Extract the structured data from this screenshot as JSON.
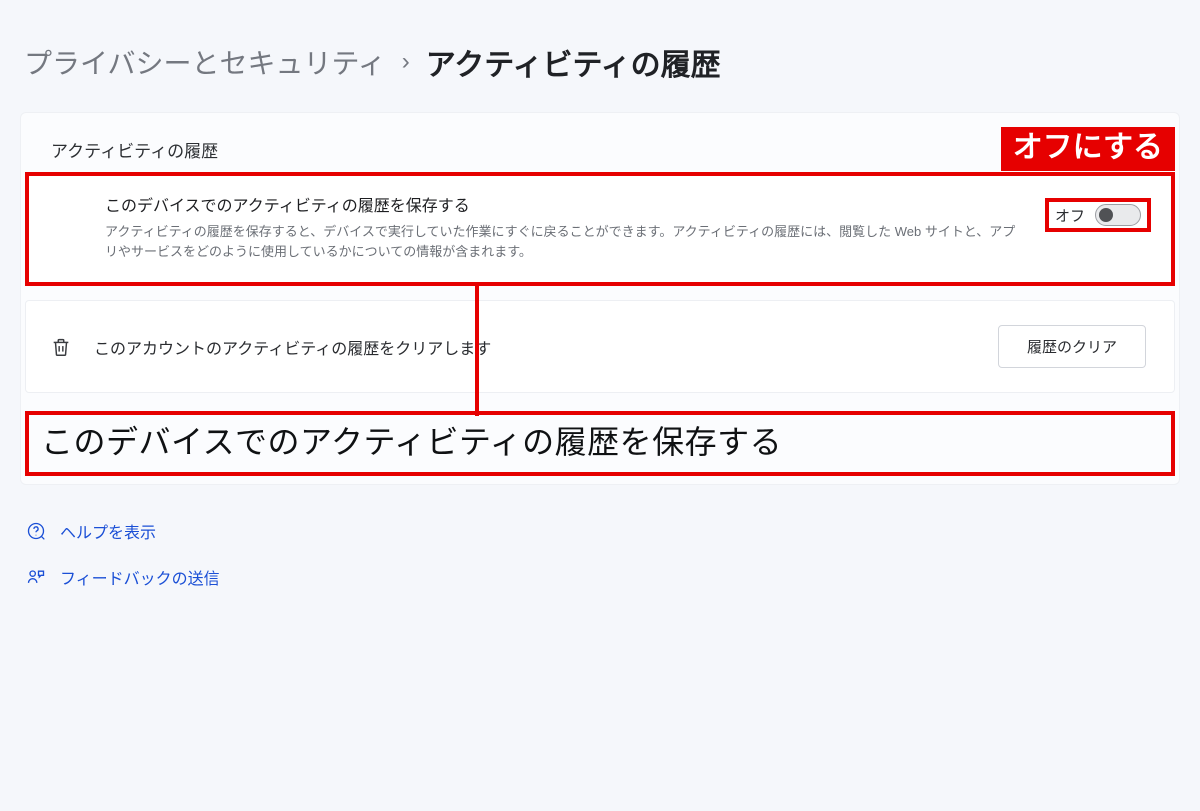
{
  "breadcrumb": {
    "parent": "プライバシーとセキュリティ",
    "current": "アクティビティの履歴"
  },
  "section": {
    "title": "アクティビティの履歴"
  },
  "callout": {
    "label": "オフにする"
  },
  "setting": {
    "title": "このデバイスでのアクティビティの履歴を保存する",
    "desc": "アクティビティの履歴を保存すると、デバイスで実行していた作業にすぐに戻ることができます。アクティビティの履歴には、閲覧した Web サイトと、アプリやサービスをどのように使用しているかについての情報が含まれます。",
    "toggle_label": "オフ",
    "toggle_state": "off"
  },
  "clear": {
    "text": "このアカウントのアクティビティの履歴をクリアします",
    "button": "履歴のクリア"
  },
  "enlarge": {
    "text": "このデバイスでのアクティビティの履歴を保存する"
  },
  "links": {
    "help": "ヘルプを表示",
    "feedback": "フィードバックの送信"
  },
  "colors": {
    "accent_red": "#e60000",
    "link_blue": "#1a4fd6"
  }
}
